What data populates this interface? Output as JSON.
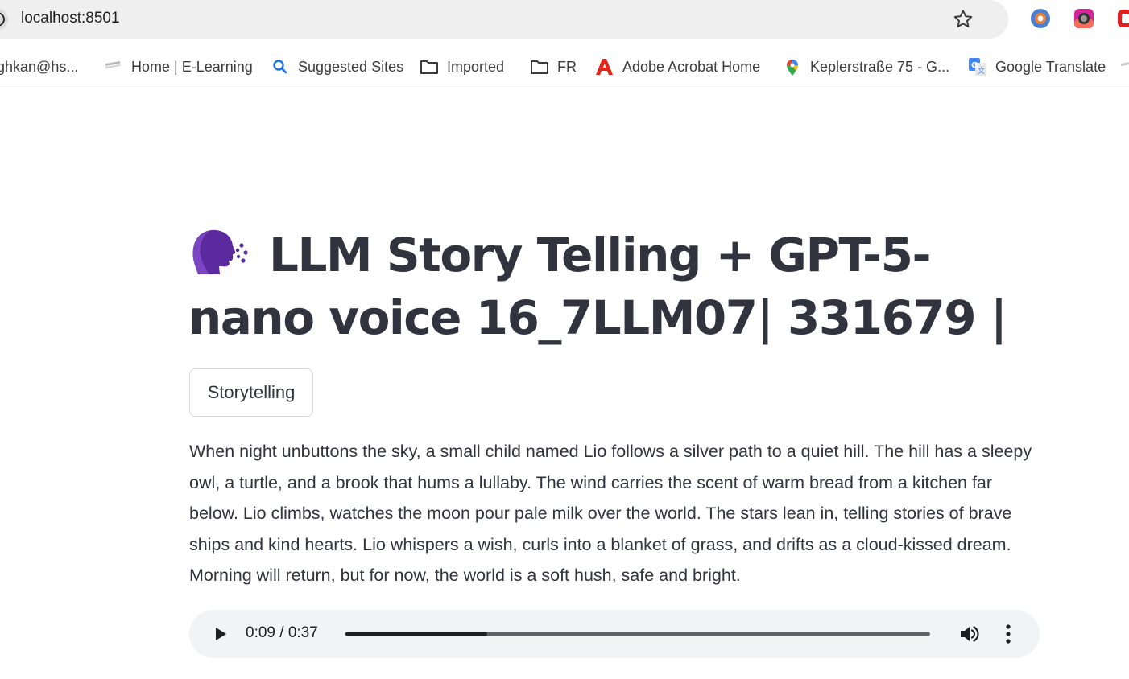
{
  "browser": {
    "url": "localhost:8501",
    "bookmarks": [
      {
        "label": "ghkan@hs...",
        "icon": "none"
      },
      {
        "label": "Home | E-Learning",
        "icon": "e-learning-icon"
      },
      {
        "label": "Suggested Sites",
        "icon": "search-icon"
      },
      {
        "label": "Imported",
        "icon": "folder-icon"
      },
      {
        "label": "FR",
        "icon": "folder-icon"
      },
      {
        "label": "Adobe Acrobat Home",
        "icon": "adobe-acrobat-icon"
      },
      {
        "label": "Keplerstraße 75 - G...",
        "icon": "map-pin-icon"
      },
      {
        "label": "Google Translate",
        "icon": "translate-icon"
      }
    ]
  },
  "app": {
    "title_icon": "speaking-head-icon",
    "title": "LLM Story Telling + GPT-5-nano voice 16_7LLM07| 331679 |",
    "tag": "Storytelling",
    "story": "When night unbuttons the sky, a small child named Lio follows a silver path to a quiet hill. The hill has a sleepy owl, a turtle, and a brook that hums a lullaby. The wind carries the scent of warm bread from a kitchen far below. Lio climbs, watches the moon pour pale milk over the world. The stars lean in, telling stories of brave ships and kind hearts. Lio whispers a wish, curls into a blanket of grass, and drifts as a cloud-kissed dream. Morning will return, but for now, the world is a soft hush, safe and bright.",
    "audio": {
      "time_display": "0:09 / 0:37",
      "progress_fraction": 0.243
    }
  },
  "colors": {
    "text": "#31333f",
    "title_icon": "#5b2a9e",
    "audio_bg": "#f1f3f4"
  }
}
